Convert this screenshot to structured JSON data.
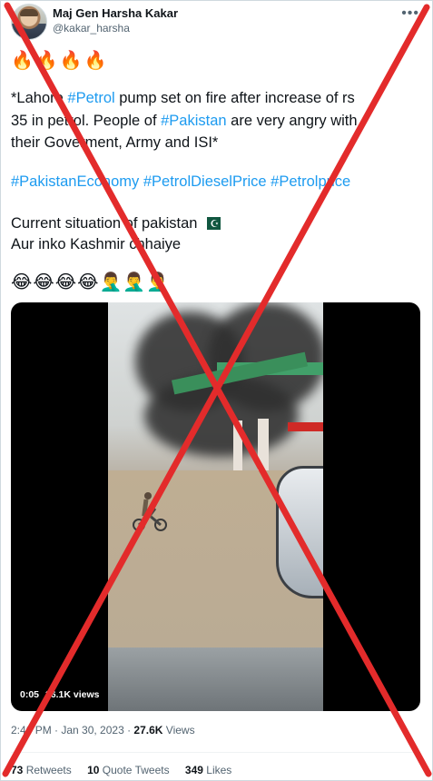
{
  "author": {
    "name": "Maj Gen Harsha Kakar",
    "handle": "@kakar_harsha"
  },
  "more_label": "•••",
  "tweet": {
    "fires": "🔥🔥🔥🔥",
    "line1_a": "*Lahore ",
    "line1_tag": "#Petrol",
    "line1_b": " pump set on fire after increase of rs",
    "line2_a": "35 in petrol. People of ",
    "line2_tag": "#Pakistan",
    "line2_b": " are very angry with",
    "line3": "their Goverment, Army and ISI*",
    "tags": [
      "#PakistanEconomy",
      "#PetrolDieselPrice",
      "#Petrolprice"
    ],
    "line5": "Current situation of pakistan",
    "line6": "Aur inko Kashmir chhaiye",
    "emojis": "😂😂😂😂🤦‍♂️🤦‍♂️🤦‍♂️"
  },
  "video": {
    "time": "0:05",
    "views": "26.1K views"
  },
  "meta": {
    "timestamp": "2:46 PM · Jan 30, 2023",
    "separator": " · ",
    "views_count": "27.6K",
    "views_label": " Views"
  },
  "engagement": {
    "retweets_count": "73",
    "retweets_label": " Retweets",
    "quotes_count": "10",
    "quotes_label": " Quote Tweets",
    "likes_count": "349",
    "likes_label": " Likes"
  },
  "colors": {
    "link": "#1d9bf0",
    "fact_check_cross": "#e32b2b"
  }
}
